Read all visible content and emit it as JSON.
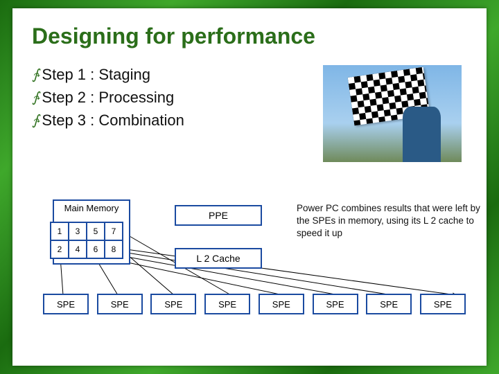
{
  "title": "Designing for performance",
  "steps": [
    "Step 1 : Staging",
    "Step 2 : Processing",
    "Step 3 : Combination"
  ],
  "diagram": {
    "main_memory_label": "Main Memory",
    "cells": [
      "1",
      "3",
      "5",
      "7",
      "2",
      "4",
      "6",
      "8"
    ],
    "ppe_label": "PPE",
    "l2_label": "L 2 Cache",
    "spe_label": "SPE",
    "spe_count": 8
  },
  "description": "Power PC combines results that were left by the SPEs in memory, using its L 2 cache to speed it up",
  "colors": {
    "title": "#2b6e1a",
    "box_border": "#1a4aa0"
  }
}
